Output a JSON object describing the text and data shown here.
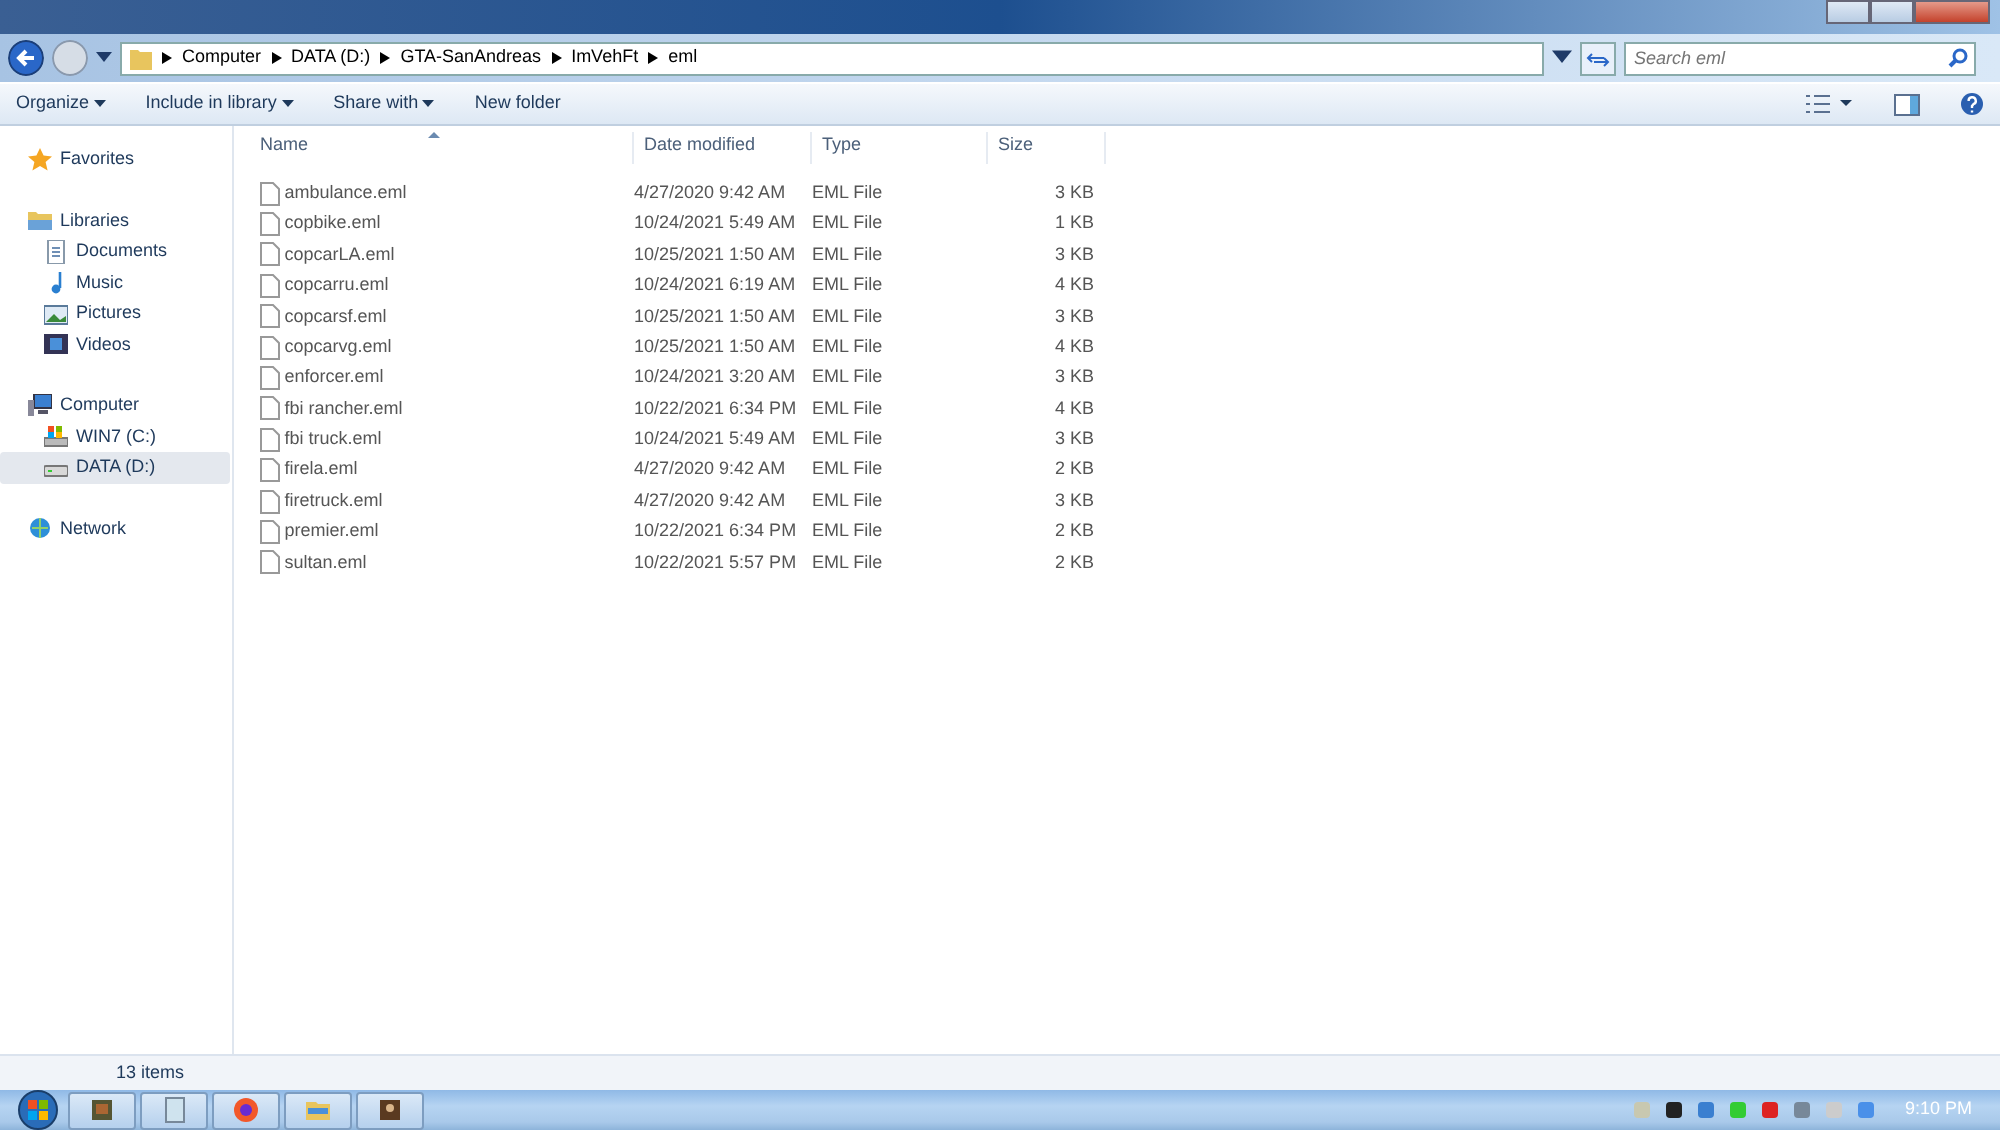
{
  "address_bar": {
    "path": [
      "Computer",
      "DATA (D:)",
      "GTA-SanAndreas",
      "ImVehFt",
      "eml"
    ]
  },
  "search": {
    "placeholder": "Search eml"
  },
  "toolbar": {
    "buttons": [
      {
        "label": "Organize",
        "dropdown": true
      },
      {
        "label": "Include in library",
        "dropdown": true
      },
      {
        "label": "Share with",
        "dropdown": true
      },
      {
        "label": "New folder",
        "dropdown": false
      }
    ]
  },
  "sidebar": {
    "items": [
      {
        "label": "Favorites",
        "selected": false
      },
      {
        "label": "Libraries",
        "selected": false,
        "children": [
          {
            "label": "Documents",
            "selected": false
          },
          {
            "label": "Music",
            "selected": false
          },
          {
            "label": "Pictures",
            "selected": false
          },
          {
            "label": "Videos",
            "selected": false
          }
        ]
      },
      {
        "label": "Computer",
        "selected": false,
        "children": [
          {
            "label": "WIN7 (C:)",
            "selected": false
          },
          {
            "label": "DATA (D:)",
            "selected": true
          }
        ]
      },
      {
        "label": "Network",
        "selected": false
      }
    ]
  },
  "table": {
    "columns": [
      {
        "label": "Name",
        "sorted": true
      },
      {
        "label": "Date modified",
        "sorted": false
      },
      {
        "label": "Type",
        "sorted": false
      },
      {
        "label": "Size",
        "sorted": false
      }
    ],
    "rows": [
      [
        "ambulance.eml",
        "4/27/2020 9:42 AM",
        "EML File",
        "3 KB"
      ],
      [
        "copbike.eml",
        "10/24/2021 5:49 AM",
        "EML File",
        "1 KB"
      ],
      [
        "copcarLA.eml",
        "10/25/2021 1:50 AM",
        "EML File",
        "3 KB"
      ],
      [
        "copcarru.eml",
        "10/24/2021 6:19 AM",
        "EML File",
        "4 KB"
      ],
      [
        "copcarsf.eml",
        "10/25/2021 1:50 AM",
        "EML File",
        "3 KB"
      ],
      [
        "copcarvg.eml",
        "10/25/2021 1:50 AM",
        "EML File",
        "4 KB"
      ],
      [
        "enforcer.eml",
        "10/24/2021 3:20 AM",
        "EML File",
        "3 KB"
      ],
      [
        "fbi rancher.eml",
        "10/22/2021 6:34 PM",
        "EML File",
        "4 KB"
      ],
      [
        "fbi truck.eml",
        "10/24/2021 5:49 AM",
        "EML File",
        "3 KB"
      ],
      [
        "firela.eml",
        "4/27/2020 9:42 AM",
        "EML File",
        "2 KB"
      ],
      [
        "firetruck.eml",
        "4/27/2020 9:42 AM",
        "EML File",
        "3 KB"
      ],
      [
        "premier.eml",
        "10/22/2021 6:34 PM",
        "EML File",
        "2 KB"
      ],
      [
        "sultan.eml",
        "10/22/2021 5:57 PM",
        "EML File",
        "2 KB"
      ]
    ]
  },
  "status_bar": {
    "text": "13 items"
  },
  "taskbar": {
    "time": "9:10 PM"
  }
}
